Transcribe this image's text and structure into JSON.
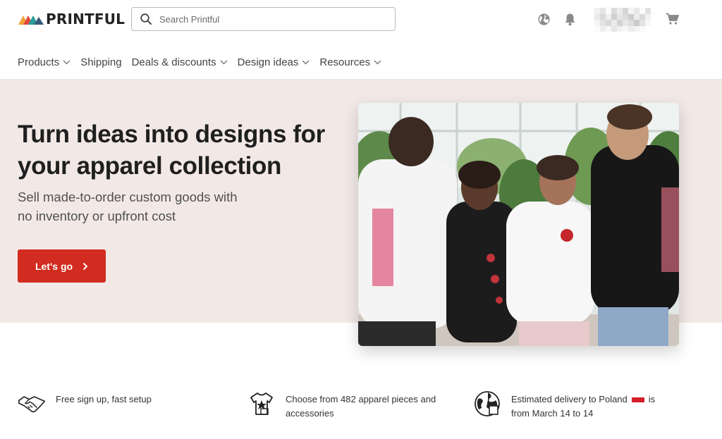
{
  "brand": {
    "name": "PRINTFUL"
  },
  "search": {
    "placeholder": "Search Printful",
    "icon": "search-icon"
  },
  "header_icons": [
    "globe-icon",
    "bell-icon",
    "cart-icon"
  ],
  "nav": {
    "items": [
      {
        "label": "Products",
        "has_dropdown": true
      },
      {
        "label": "Shipping",
        "has_dropdown": false
      },
      {
        "label": "Deals & discounts",
        "has_dropdown": true
      },
      {
        "label": "Design ideas",
        "has_dropdown": true
      },
      {
        "label": "Resources",
        "has_dropdown": true
      }
    ]
  },
  "hero": {
    "title": "Turn ideas into designs for your apparel collection",
    "subtitle": "Sell made-to-order custom goods with no inventory or upfront cost",
    "cta_label": "Let's go",
    "background": "#f2e9e7"
  },
  "features": [
    {
      "icon": "handshake-icon",
      "text": "Free sign up, fast setup"
    },
    {
      "icon": "tshirt-icon",
      "text": "Choose from 482 apparel pieces and accessories"
    },
    {
      "icon": "globe-delivery-icon",
      "text_before_flag": "Estimated delivery to Poland",
      "text_after_flag": "is from March 14 to 14"
    }
  ],
  "colors": {
    "accent": "#d12c1f",
    "hero_bg": "#f2e9e7",
    "text": "#222222"
  }
}
